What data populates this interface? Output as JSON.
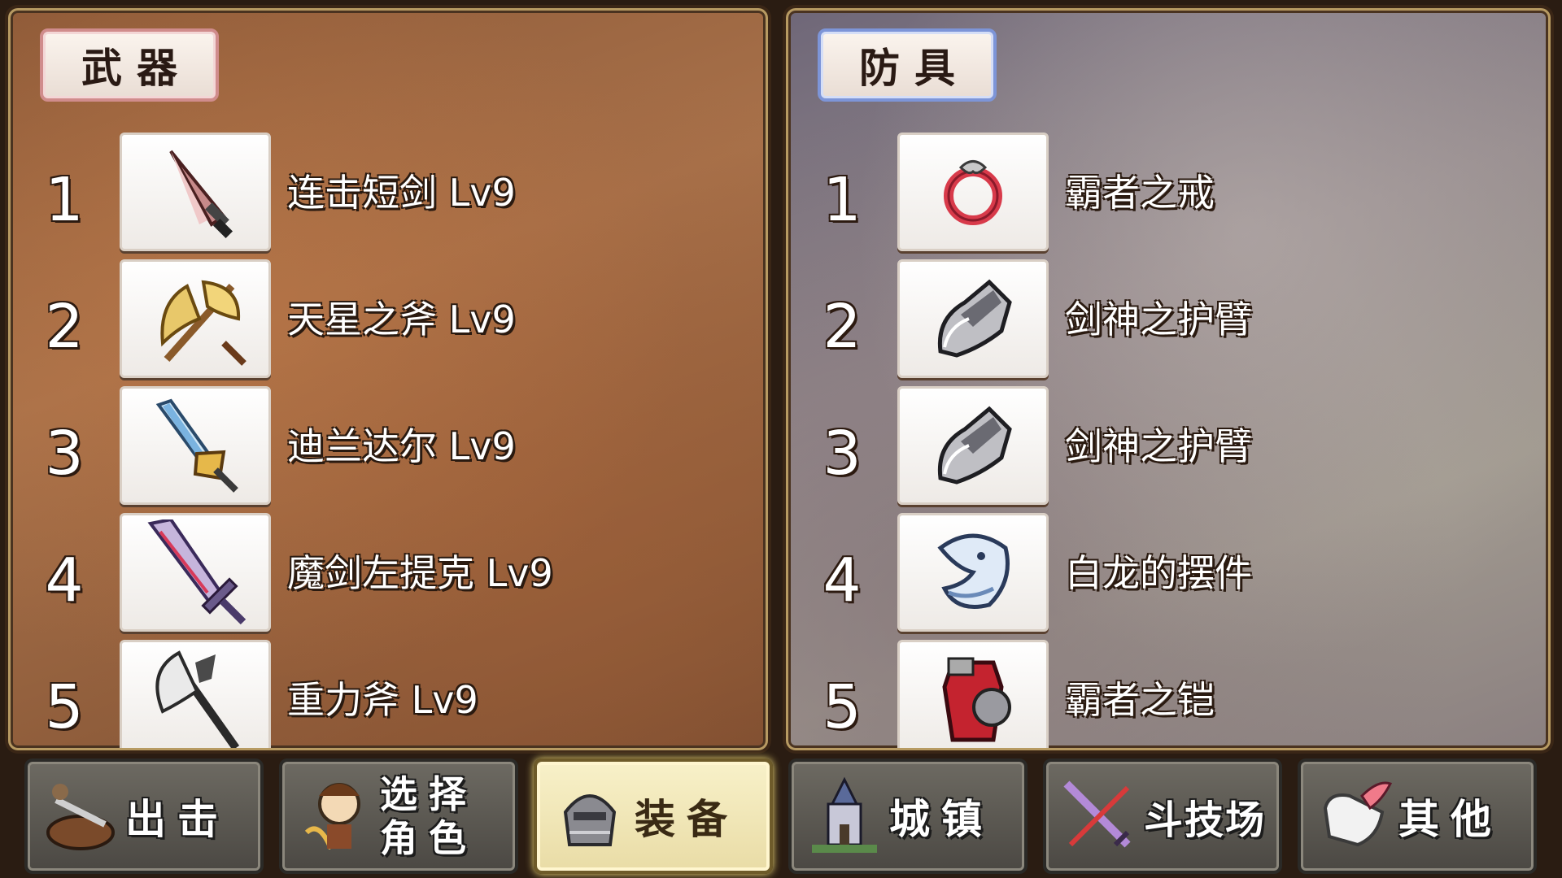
{
  "weapons": {
    "title": "武器",
    "items": [
      {
        "num": "1",
        "name": "连击短剑 Lv9",
        "icon": "dagger-icon"
      },
      {
        "num": "2",
        "name": "天星之斧 Lv9",
        "icon": "golden-axe-icon"
      },
      {
        "num": "3",
        "name": "迪兰达尔 Lv9",
        "icon": "jeweled-sword-icon"
      },
      {
        "num": "4",
        "name": "魔剑左提克 Lv9",
        "icon": "demon-sword-icon"
      },
      {
        "num": "5",
        "name": "重力斧 Lv9",
        "icon": "battle-axe-icon"
      }
    ]
  },
  "armor": {
    "title": "防具",
    "items": [
      {
        "num": "1",
        "name": "霸者之戒",
        "icon": "ring-icon"
      },
      {
        "num": "2",
        "name": "剑神之护臂",
        "icon": "gauntlet-icon"
      },
      {
        "num": "3",
        "name": "剑神之护臂",
        "icon": "gauntlet-icon"
      },
      {
        "num": "4",
        "name": "白龙的摆件",
        "icon": "white-dragon-icon"
      },
      {
        "num": "5",
        "name": "霸者之铠",
        "icon": "armor-icon"
      }
    ]
  },
  "nav": {
    "sortie": "出击",
    "select_line1": "选择",
    "select_line2": "角色",
    "equipment": "装备",
    "town": "城镇",
    "arena": "斗技场",
    "other": "其他",
    "active": "equipment"
  }
}
